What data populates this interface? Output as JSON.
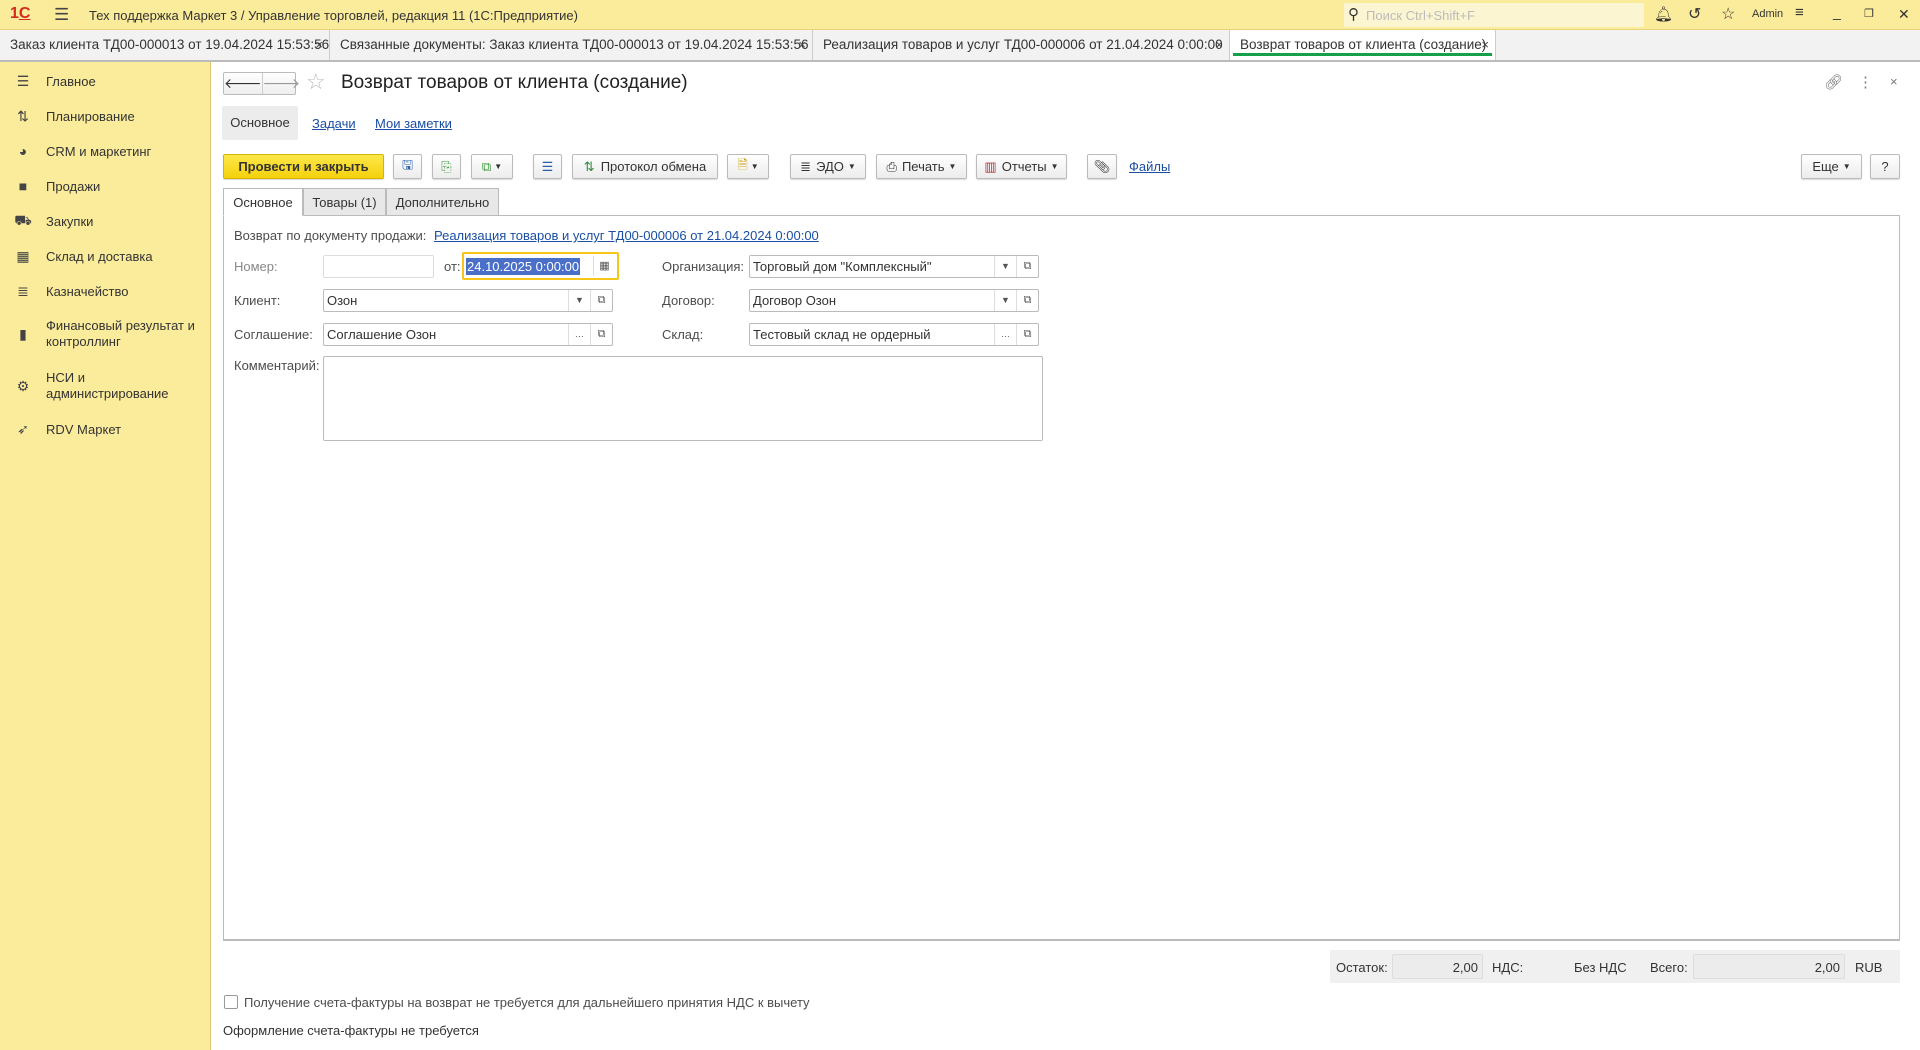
{
  "app": {
    "title": "Тех поддержка Маркет 3 / Управление торговлей, редакция 11  (1С:Предприятие)",
    "search_placeholder": "Поиск Ctrl+Shift+F",
    "user": "Admin"
  },
  "window_tabs": [
    {
      "label": "Заказ клиента ТД00-000013 от 19.04.2024 15:53:56"
    },
    {
      "label": "Связанные документы: Заказ клиента ТД00-000013 от 19.04.2024 15:53:56"
    },
    {
      "label": "Реализация товаров и услуг ТД00-000006 от 21.04.2024 0:00:00"
    },
    {
      "label": "Возврат товаров от клиента (создание)",
      "active": true
    }
  ],
  "sidebar": {
    "items": [
      {
        "label": "Главное",
        "icon": "menu-icon"
      },
      {
        "label": "Планирование",
        "icon": "planning-icon"
      },
      {
        "label": "CRM и маркетинг",
        "icon": "pie-chart-icon"
      },
      {
        "label": "Продажи",
        "icon": "shopping-bag-icon"
      },
      {
        "label": "Закупки",
        "icon": "cart-icon"
      },
      {
        "label": "Склад и доставка",
        "icon": "warehouse-icon"
      },
      {
        "label": "Казначейство",
        "icon": "coins-icon"
      },
      {
        "label": "Финансовый результат и контроллинг",
        "icon": "bar-chart-icon"
      },
      {
        "label": "НСИ и администрирование",
        "icon": "gear-icon"
      },
      {
        "label": "RDV Маркет",
        "icon": "rocket-icon"
      }
    ]
  },
  "form": {
    "title": "Возврат товаров от клиента (создание)",
    "subtabs": [
      "Основное",
      "Задачи",
      "Мои заметки"
    ],
    "toolbar": {
      "post_close": "Провести и закрыть",
      "exchange_log": "Протокол обмена",
      "edo": "ЭДО",
      "print": "Печать",
      "reports": "Отчеты",
      "files": "Файлы",
      "more": "Еще",
      "help": "?"
    },
    "tabs": [
      "Основное",
      "Товары (1)",
      "Дополнительно"
    ],
    "base_doc_label": "Возврат по документу продажи:",
    "base_doc_link": "Реализация товаров и услуг ТД00-000006 от 21.04.2024 0:00:00",
    "number_label": "Номер:",
    "number_value": "",
    "date_label": "от:",
    "date_value": "24.10.2025  0:00:00",
    "client_label": "Клиент:",
    "client_value": "Озон",
    "agreement_label": "Соглашение:",
    "agreement_value": "Соглашение Озон",
    "org_label": "Организация:",
    "org_value": "Торговый дом \"Комплексный\"",
    "contract_label": "Договор:",
    "contract_value": "Договор Озон",
    "warehouse_label": "Склад:",
    "warehouse_value": "Тестовый склад не ордерный",
    "comment_label": "Комментарий:",
    "comment_value": "",
    "totals": {
      "balance_label": "Остаток:",
      "balance": "2,00",
      "vat_label": "НДС:",
      "vat": "Без НДС",
      "total_label": "Всего:",
      "total": "2,00",
      "currency": "RUB"
    },
    "invoice_checkbox": "Получение счета-фактуры на возврат не требуется для дальнейшего принятия НДС к вычету",
    "invoice_checked": false,
    "invoice_status": "Оформление счета-фактуры не требуется"
  }
}
